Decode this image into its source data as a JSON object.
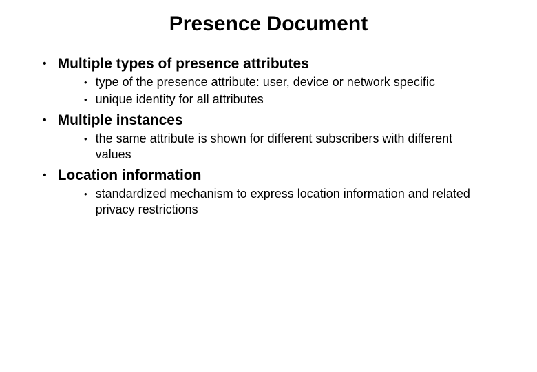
{
  "title": "Presence Document",
  "items": [
    {
      "label": "Multiple types of presence attributes",
      "subs": [
        "type of the presence attribute: user, device or network specific",
        "unique identity for all attributes"
      ]
    },
    {
      "label": "Multiple instances",
      "subs": [
        "the same attribute is shown for different subscribers with different values"
      ]
    },
    {
      "label": "Location information",
      "subs": [
        "standardized mechanism to express location information and related privacy restrictions"
      ]
    }
  ]
}
